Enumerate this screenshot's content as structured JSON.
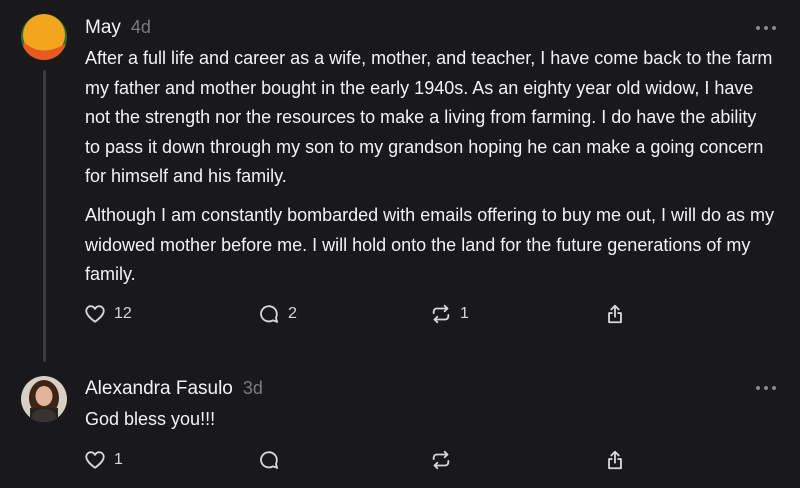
{
  "posts": [
    {
      "author": "May",
      "time": "4d",
      "paragraphs": [
        "After a full life and career as a wife, mother, and teacher, I have come back to the farm my father and mother bought in the early 1940s. As an eighty year old widow, I have not the strength nor the resources to make a living from farming. I do have the ability to pass it down through my son to my grandson hoping he can make a going concern for himself and his family.",
        "Although I am constantly bombarded with emails offering to buy me out, I will do as my widowed mother before me. I will hold onto the land for the future generations of my family."
      ],
      "likes": "12",
      "comments": "2",
      "reposts": "1"
    },
    {
      "author": "Alexandra Fasulo",
      "time": "3d",
      "text": "God bless you!!!",
      "likes": "1",
      "comments": "",
      "reposts": ""
    }
  ],
  "icons": {
    "like": "heart-icon",
    "comment": "comment-bubble-icon",
    "repost": "repost-icon",
    "share": "share-icon",
    "more": "more-dots-icon"
  },
  "colors": {
    "background": "#19191b",
    "text": "#f3f3f5",
    "muted": "#7b7b80",
    "thread_line": "#3a3a3d"
  }
}
